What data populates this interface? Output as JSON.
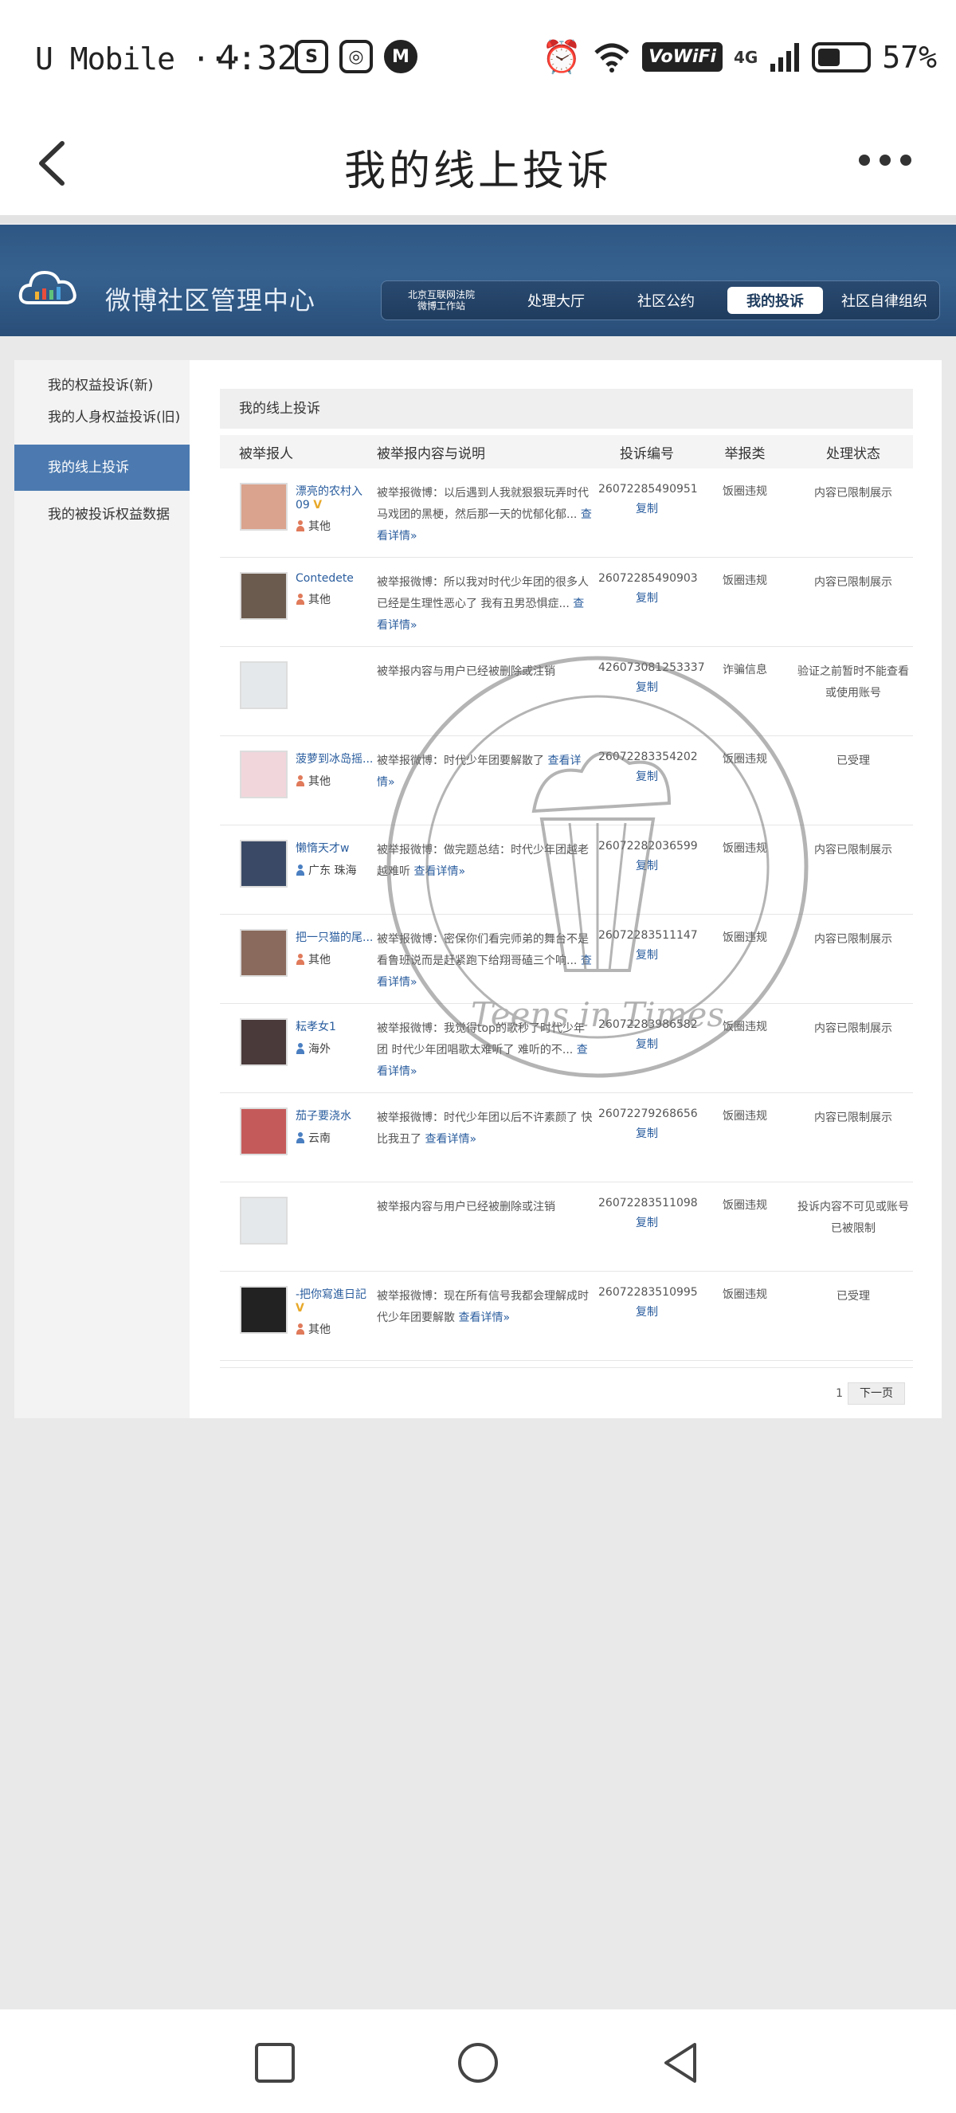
{
  "status_bar": {
    "carrier": "U Mobile ···",
    "time": "4:32",
    "vowifi": "VoWiFi",
    "signal": "4G",
    "battery": "57%"
  },
  "app_header": {
    "title": "我的线上投诉"
  },
  "site": {
    "brand": "微博社区管理中心",
    "nav": [
      {
        "label": "北京互联网法院\n微博工作站"
      },
      {
        "label": "处理大厅"
      },
      {
        "label": "社区公约"
      },
      {
        "label": "我的投诉",
        "active": true
      },
      {
        "label": "社区自律组织"
      }
    ]
  },
  "sidebar": {
    "items": [
      {
        "label": "我的权益投诉(新)"
      },
      {
        "label": "我的人身权益投诉(旧)"
      },
      {
        "label": "我的线上投诉",
        "active": true
      },
      {
        "label": "我的被投诉权益数据"
      }
    ]
  },
  "main": {
    "title": "我的线上投诉",
    "columns": [
      "被举报人",
      "被举报内容与说明",
      "投诉编号",
      "举报类",
      "处理状态"
    ],
    "rows": [
      {
        "name": "漂亮的农村入09",
        "vip": "V",
        "location": "其他",
        "desc": "被举报微博：以后遇到人我就狠狠玩弄时代马戏团的黑梗，然后那一天的忧郁化郁...",
        "more": "查看详情»",
        "id": "26072285490951",
        "copy": "复制",
        "type": "饭圈违规",
        "status": "内容已限制展示"
      },
      {
        "name": "Contedete",
        "vip": "",
        "location": "其他",
        "desc": "被举报微博：所以我对时代少年团的很多人已经是生理性恶心了 我有丑男恐惧症...",
        "more": "查看详情»",
        "id": "26072285490903",
        "copy": "复制",
        "type": "饭圈违规",
        "status": "内容已限制展示"
      },
      {
        "name": "",
        "vip": "",
        "location": "",
        "desc": "被举报内容与用户已经被删除或注销",
        "more": "",
        "id": "426073081253337",
        "copy": "复制",
        "type": "诈骗信息",
        "status": "验证之前暂时不能查看或使用账号"
      },
      {
        "name": "菠萝到冰岛摇...",
        "vip": "",
        "location": "其他",
        "desc": "被举报微博：时代少年团要解散了",
        "more": "查看详情»",
        "id": "26072283354202",
        "copy": "复制",
        "type": "饭圈违规",
        "status": "已受理"
      },
      {
        "name": "懒惰天才w",
        "vip": "",
        "location": "广东 珠海",
        "desc": "被举报微博：做完题总结：时代少年团越老越难听",
        "more": "查看详情»",
        "id": "26072282036599",
        "copy": "复制",
        "type": "饭圈违规",
        "status": "内容已限制展示"
      },
      {
        "name": "把一只猫的尾...",
        "vip": "",
        "location": "其他",
        "desc": "被举报微博：密保你们看完师弟的舞台不是看鲁班说而是赶紧跑下给翔哥磕三个响...",
        "more": "查看详情»",
        "id": "26072283511147",
        "copy": "复制",
        "type": "饭圈违规",
        "status": "内容已限制展示"
      },
      {
        "name": "耘孝女1",
        "vip": "",
        "location": "海外",
        "desc": "被举报微博：我觉得top的歌秒了时代少年团 时代少年团唱歌太难听了 难听的不...",
        "more": "查看详情»",
        "id": "26072283986582",
        "copy": "复制",
        "type": "饭圈违规",
        "status": "内容已限制展示"
      },
      {
        "name": "茄子要浇水",
        "vip": "",
        "location": "云南",
        "desc": "被举报微博：时代少年团以后不许素颜了 快比我丑了",
        "more": "查看详情»",
        "id": "26072279268656",
        "copy": "复制",
        "type": "饭圈违规",
        "status": "内容已限制展示"
      },
      {
        "name": "",
        "vip": "",
        "location": "",
        "desc": "被举报内容与用户已经被删除或注销",
        "more": "",
        "id": "26072283511098",
        "copy": "复制",
        "type": "饭圈违规",
        "status": "投诉内容不可见或账号已被限制"
      },
      {
        "name": "-把你寫進日記",
        "vip": "V",
        "location": "其他",
        "desc": "被举报微博：现在所有信号我都会理解成时代少年团要解散",
        "more": "查看详情»",
        "id": "26072283510995",
        "copy": "复制",
        "type": "饭圈违规",
        "status": "已受理"
      }
    ]
  },
  "pager": {
    "page": "1",
    "next": "下一页"
  },
  "watermark": {
    "text": "Teens in Times"
  },
  "colors": {
    "banner": "#2f5784",
    "active_side": "#4c7ab0",
    "link": "#2a5d9e"
  }
}
